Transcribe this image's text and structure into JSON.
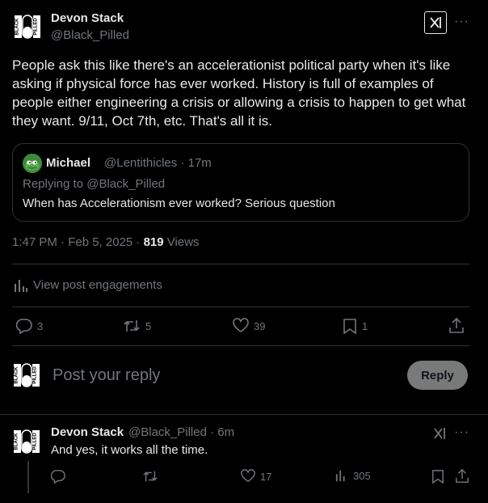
{
  "post": {
    "author_name": "Devon Stack",
    "author_handle": "@Black_Pilled",
    "text": "People ask this like there's an accelerationist political party when it's like asking if physical force has ever worked. History is full of examples of people either engineering a crisis or allowing a crisis to happen to get what they want. 9/11, Oct 7th, etc. That's all it is.",
    "more_label": "···",
    "quote": {
      "name": "Michael",
      "handle_time": "@Lentithicles · 17m",
      "replying_to": "Replying to @Black_Pilled",
      "text": "When has Accelerationism ever worked?  Serious question"
    },
    "timestamp": "1:47 PM · Feb 5, 2025 · ",
    "views_count": "819",
    "views_label": " Views",
    "engagements_label": "View post engagements",
    "actions": {
      "replies": "3",
      "reposts": "5",
      "likes": "39",
      "bookmarks": "1"
    }
  },
  "composer": {
    "placeholder": "Post your reply",
    "reply_button": "Reply"
  },
  "reply": {
    "author_name": "Devon Stack",
    "author_handle_time": "@Black_Pilled · 6m",
    "text": "And yes, it works all the time.",
    "more_label": "···",
    "actions": {
      "likes": "17",
      "views": "305"
    }
  },
  "colors": {
    "background": "#000000",
    "text_primary": "#e7e9ea",
    "text_secondary": "#71767b",
    "border": "#2f3336",
    "reply_button_bg": "#787a7a"
  }
}
